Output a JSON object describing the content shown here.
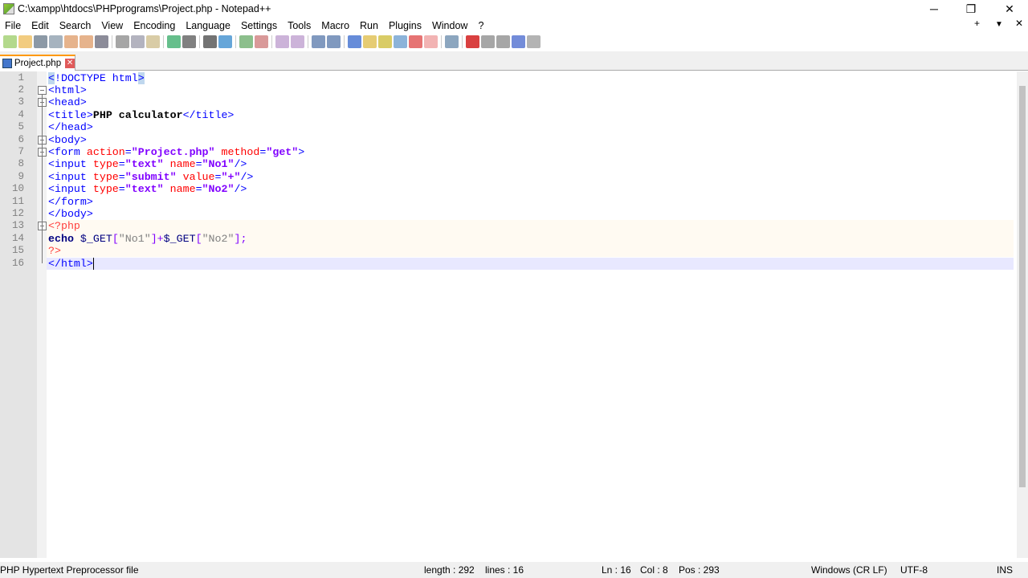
{
  "window": {
    "title": "C:\\xampp\\htdocs\\PHPprograms\\Project.php - Notepad++",
    "minimize": "─",
    "restore": "❐",
    "close": "✕"
  },
  "menu": [
    "File",
    "Edit",
    "Search",
    "View",
    "Encoding",
    "Language",
    "Settings",
    "Tools",
    "Macro",
    "Run",
    "Plugins",
    "Window",
    "?"
  ],
  "menu_right": {
    "add": "+",
    "dropdown": "▼",
    "close": "✕"
  },
  "toolbar": [
    "new",
    "open",
    "save",
    "save-all",
    "close",
    "close-all",
    "print",
    "cut",
    "copy",
    "paste",
    "undo",
    "redo",
    "find",
    "replace",
    "zoom-in",
    "zoom-out",
    "sync-v",
    "sync-h",
    "word-wrap",
    "show-all",
    "indent-guide",
    "udl",
    "doc-map",
    "function-list",
    "folder-workspace",
    "monitor",
    "eye",
    "record",
    "stop",
    "play",
    "run-multiple",
    "save-macro"
  ],
  "tab": {
    "label": "Project.php",
    "close": "✕"
  },
  "lines": [
    [
      [
        "<",
        "t-tag t-hl"
      ],
      [
        "!DOCTYPE html",
        "t-tag"
      ],
      [
        ">",
        "t-tag t-hl"
      ]
    ],
    [
      [
        "<html>",
        "t-tag"
      ]
    ],
    [
      [
        "<head>",
        "t-tag"
      ]
    ],
    [
      [
        "<title>",
        "t-tag"
      ],
      [
        "PHP calculator",
        "t-txt"
      ],
      [
        "</title>",
        "t-tag"
      ]
    ],
    [
      [
        "</head>",
        "t-tag"
      ]
    ],
    [
      [
        "<body>",
        "t-tag"
      ]
    ],
    [
      [
        "<form ",
        "t-tag"
      ],
      [
        "action",
        "t-attr"
      ],
      [
        "=",
        "t-tag"
      ],
      [
        "\"Project.php\"",
        "t-val"
      ],
      [
        " ",
        "t-tag"
      ],
      [
        "method",
        "t-attr"
      ],
      [
        "=",
        "t-tag"
      ],
      [
        "\"get\"",
        "t-val"
      ],
      [
        ">",
        "t-tag"
      ]
    ],
    [
      [
        "<input ",
        "t-tag"
      ],
      [
        "type",
        "t-attr"
      ],
      [
        "=",
        "t-tag"
      ],
      [
        "\"text\"",
        "t-val"
      ],
      [
        " ",
        "t-tag"
      ],
      [
        "name",
        "t-attr"
      ],
      [
        "=",
        "t-tag"
      ],
      [
        "\"No1\"",
        "t-val"
      ],
      [
        "/>",
        "t-tag"
      ]
    ],
    [
      [
        "<input ",
        "t-tag"
      ],
      [
        "type",
        "t-attr"
      ],
      [
        "=",
        "t-tag"
      ],
      [
        "\"submit\"",
        "t-val"
      ],
      [
        " ",
        "t-tag"
      ],
      [
        "value",
        "t-attr"
      ],
      [
        "=",
        "t-tag"
      ],
      [
        "\"+\"",
        "t-val"
      ],
      [
        "/>",
        "t-tag"
      ]
    ],
    [
      [
        "<input ",
        "t-tag"
      ],
      [
        "type",
        "t-attr"
      ],
      [
        "=",
        "t-tag"
      ],
      [
        "\"text\"",
        "t-val"
      ],
      [
        " ",
        "t-tag"
      ],
      [
        "name",
        "t-attr"
      ],
      [
        "=",
        "t-tag"
      ],
      [
        "\"No2\"",
        "t-val"
      ],
      [
        "/>",
        "t-tag"
      ]
    ],
    [
      [
        "</form>",
        "t-tag"
      ]
    ],
    [
      [
        "</body>",
        "t-tag"
      ]
    ],
    [
      [
        "<?php",
        "t-php"
      ]
    ],
    [
      [
        "echo",
        "t-kw"
      ],
      [
        " $_GET",
        "t-var"
      ],
      [
        "[",
        "t-op"
      ],
      [
        "\"No1\"",
        "t-str"
      ],
      [
        "]+",
        "t-op"
      ],
      [
        "$_GET",
        "t-var"
      ],
      [
        "[",
        "t-op"
      ],
      [
        "\"No2\"",
        "t-str"
      ],
      [
        "];",
        "t-op"
      ]
    ],
    [
      [
        "?>",
        "t-php"
      ]
    ],
    [
      [
        "</html>",
        "t-tag"
      ]
    ]
  ],
  "status": {
    "filetype": "PHP Hypertext Preprocessor file",
    "length": "length : 292",
    "lines": "lines : 16",
    "ln": "Ln : 16",
    "col": "Col : 8",
    "pos": "Pos : 293",
    "eol": "Windows (CR LF)",
    "encoding": "UTF-8",
    "mode": "INS"
  }
}
